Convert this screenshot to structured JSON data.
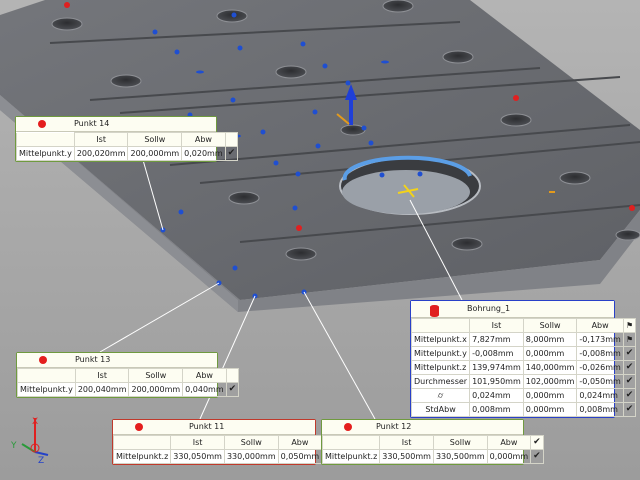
{
  "palette": {
    "background": "#a6a6a6",
    "plate": "#6b6d72",
    "point": "#1f4fd1",
    "fail_point": "#e02020",
    "pass": "#5a9a3a",
    "fail": "#c41e1e"
  },
  "icons": {
    "pass": "checkmark-icon",
    "fail": "red-flag-icon",
    "warn": "blue-flag-icon",
    "target": "red-dot-icon",
    "cylinder": "cylinder-icon",
    "axes": "coordinate-axes-icon"
  },
  "cards": {
    "p14": {
      "title": "Punkt 14",
      "headers": [
        "Ist",
        "Sollw",
        "Abw"
      ],
      "rows": [
        {
          "label": "Mittelpunkt.y",
          "ist": "200,020mm",
          "soll": "200,000mm",
          "abw": "0,020mm"
        }
      ]
    },
    "p13": {
      "title": "Punkt 13",
      "headers": [
        "Ist",
        "Sollw",
        "Abw"
      ],
      "rows": [
        {
          "label": "Mittelpunkt.y",
          "ist": "200,040mm",
          "soll": "200,000mm",
          "abw": "0,040mm"
        }
      ]
    },
    "p11": {
      "title": "Punkt 11",
      "headers": [
        "Ist",
        "Sollw",
        "Abw"
      ],
      "rows": [
        {
          "label": "Mittelpunkt.z",
          "ist": "330,050mm",
          "soll": "330,000mm",
          "abw": "0,050mm"
        }
      ]
    },
    "p12": {
      "title": "Punkt 12",
      "headers": [
        "Ist",
        "Sollw",
        "Abw"
      ],
      "rows": [
        {
          "label": "Mittelpunkt.z",
          "ist": "330,500mm",
          "soll": "330,500mm",
          "abw": "0,000mm"
        }
      ]
    },
    "bohrung": {
      "title": "Bohrung_1",
      "headers": [
        "Ist",
        "Sollw",
        "Abw"
      ],
      "rows": [
        {
          "label": "Mittelpunkt.x",
          "ist": "7,827mm",
          "soll": "8,000mm",
          "abw": "-0,173mm"
        },
        {
          "label": "Mittelpunkt.y",
          "ist": "-0,008mm",
          "soll": "0,000mm",
          "abw": "-0,008mm"
        },
        {
          "label": "Mittelpunkt.z",
          "ist": "139,974mm",
          "soll": "140,000mm",
          "abw": "-0,026mm"
        },
        {
          "label": "Durchmesser",
          "ist": "101,950mm",
          "soll": "102,000mm",
          "abw": "-0,050mm"
        },
        {
          "label": "⌭",
          "ist": "0,024mm",
          "soll": "0,000mm",
          "abw": "0,024mm"
        },
        {
          "label": "StdAbw",
          "ist": "0,008mm",
          "soll": "0,000mm",
          "abw": "0,008mm"
        }
      ]
    }
  },
  "axes": {
    "x": "X",
    "y": "Y",
    "z": "Z"
  }
}
